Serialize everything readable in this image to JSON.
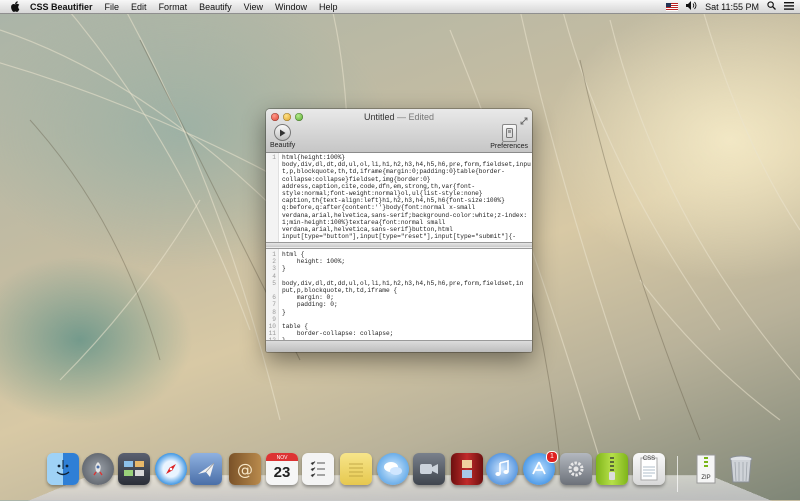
{
  "menubar": {
    "app_name": "CSS Beautifier",
    "items": [
      "File",
      "Edit",
      "Format",
      "Beautify",
      "View",
      "Window",
      "Help"
    ],
    "clock": "Sat 11:55 PM"
  },
  "window": {
    "title": "Untitled",
    "title_suffix": "— Edited",
    "beautify_label": "Beautify",
    "preferences_label": "Preferences"
  },
  "input_editor": {
    "lines": [
      {
        "num": "1",
        "code": "html{height:100%}"
      },
      {
        "num": "",
        "code": "body,div,dl,dt,dd,ul,ol,li,h1,h2,h3,h4,h5,h6,pre,form,fieldset,inpu"
      },
      {
        "num": "",
        "code": "t,p,blockquote,th,td,iframe{margin:0;padding:0}table{border-"
      },
      {
        "num": "",
        "code": "collapse:collapse}fieldset,img{border:0}"
      },
      {
        "num": "",
        "code": "address,caption,cite,code,dfn,em,strong,th,var{font-"
      },
      {
        "num": "",
        "code": "style:normal;font-weight:normal}ol,ul{list-style:none}"
      },
      {
        "num": "",
        "code": "caption,th{text-align:left}h1,h2,h3,h4,h5,h6{font-size:100%}"
      },
      {
        "num": "",
        "code": "q:before,q:after{content:''}body{font:normal x-small"
      },
      {
        "num": "",
        "code": "verdana,arial,helvetica,sans-serif;background-color:white;z-index:"
      },
      {
        "num": "",
        "code": "1;min-height:100%}textarea{font:normal small"
      },
      {
        "num": "",
        "code": "verdana,arial,helvetica,sans-serif}button,html"
      },
      {
        "num": "",
        "code": "input[type=\"button\"],input[type=\"reset\"],input[type=\"submit\"]{-"
      }
    ]
  },
  "output_editor": {
    "lines": [
      {
        "num": "1",
        "code": "html {"
      },
      {
        "num": "2",
        "code": "    height: 100%;"
      },
      {
        "num": "3",
        "code": "}"
      },
      {
        "num": "4",
        "code": ""
      },
      {
        "num": "5",
        "code": "body,div,dl,dt,dd,ul,ol,li,h1,h2,h3,h4,h5,h6,pre,form,fieldset,in"
      },
      {
        "num": "",
        "code": "put,p,blockquote,th,td,iframe {"
      },
      {
        "num": "6",
        "code": "    margin: 0;"
      },
      {
        "num": "7",
        "code": "    padding: 0;"
      },
      {
        "num": "8",
        "code": "}"
      },
      {
        "num": "9",
        "code": ""
      },
      {
        "num": "10",
        "code": "table {"
      },
      {
        "num": "11",
        "code": "    border-collapse: collapse;"
      },
      {
        "num": "12",
        "code": "}"
      }
    ]
  },
  "dock": {
    "items": [
      {
        "name": "finder",
        "icon": "finder-icon",
        "color": "#3a7fd8"
      },
      {
        "name": "launchpad",
        "icon": "rocket-icon",
        "color": "#6b6f78"
      },
      {
        "name": "mission-control",
        "icon": "mission-control-icon",
        "color": "#3a3f4a"
      },
      {
        "name": "safari",
        "icon": "compass-icon",
        "color": "#2b8be0"
      },
      {
        "name": "mail",
        "icon": "stamp-icon",
        "color": "#5a7bb5"
      },
      {
        "name": "contacts",
        "icon": "address-book-icon",
        "color": "#a87a3a"
      },
      {
        "name": "calendar",
        "icon": "calendar-icon",
        "color": "#f4f4f4",
        "month": "NOV",
        "day": "23"
      },
      {
        "name": "reminders",
        "icon": "checklist-icon",
        "color": "#f2f2f2"
      },
      {
        "name": "notes",
        "icon": "notepad-icon",
        "color": "#f2d86a"
      },
      {
        "name": "messages",
        "icon": "speech-bubbles-icon",
        "color": "#4aa2e8"
      },
      {
        "name": "facetime",
        "icon": "camera-icon",
        "color": "#5c6470"
      },
      {
        "name": "photo-booth",
        "icon": "photo-booth-icon",
        "color": "#b22a2a"
      },
      {
        "name": "itunes",
        "icon": "music-note-icon",
        "color": "#2b7fd8"
      },
      {
        "name": "app-store",
        "icon": "app-store-icon",
        "color": "#2a8de6",
        "badge": "1"
      },
      {
        "name": "system-preferences",
        "icon": "gear-icon",
        "color": "#8a8f96"
      },
      {
        "name": "archive-utility",
        "icon": "zipper-icon",
        "color": "#9acb2a"
      },
      {
        "name": "css-beautifier",
        "icon": "css-document-icon",
        "color": "#e8e8e8",
        "label": "CSS"
      },
      {
        "name": "zip-file",
        "icon": "zip-file-icon",
        "color": "#e8e8e8",
        "label": "ZIP"
      },
      {
        "name": "trash",
        "icon": "trash-icon",
        "color": "#c9ccd1"
      }
    ]
  }
}
